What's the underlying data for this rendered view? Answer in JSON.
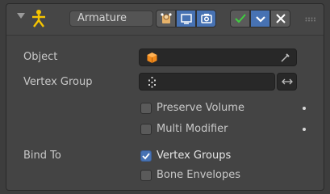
{
  "header": {
    "name_value": "Armature",
    "icons": {
      "collapse": "collapse-arrow-icon",
      "modifier_type": "armature-icon",
      "edit_mode": "edit-mode-icon",
      "viewport": "viewport-display-icon",
      "render": "render-camera-icon",
      "apply": "apply-check-icon",
      "copy": "copy-chevron-icon",
      "remove": "remove-x-icon",
      "drag": "drag-handle-icon"
    },
    "colors": {
      "accent": "#4772b3",
      "armature_icon": "#f5c400",
      "apply_check": "#3fcf3f"
    }
  },
  "rows": {
    "object_label": "Object",
    "vertex_group_label": "Vertex Group",
    "bind_to_label": "Bind To"
  },
  "checkboxes": {
    "preserve_volume": {
      "label": "Preserve Volume",
      "checked": false
    },
    "multi_modifier": {
      "label": "Multi Modifier",
      "checked": false
    },
    "vertex_groups": {
      "label": "Vertex Groups",
      "checked": true
    },
    "bone_envelopes": {
      "label": "Bone Envelopes",
      "checked": false
    }
  }
}
